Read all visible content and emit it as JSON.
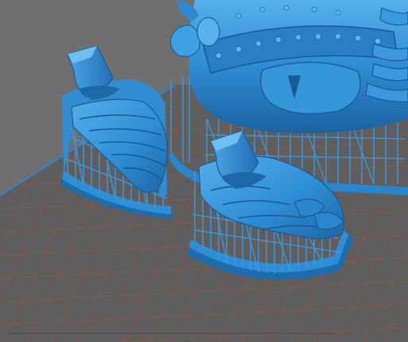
{
  "viewport": {
    "background_color": "#6f6f6f",
    "build_plate": {
      "fill": "#5d5d5d",
      "grid_color": "#a0533c",
      "border_color": "#3d7fc2"
    },
    "model_color": "#2f8fd6",
    "model_shadow_color": "#1c5f98",
    "model_highlight_color": "#63b8ee",
    "support_color": "#3a97db"
  },
  "objects": [
    {
      "name": "left-foot",
      "kind": "model-part",
      "has_supports": true
    },
    {
      "name": "right-foot",
      "kind": "model-part",
      "has_supports": true
    },
    {
      "name": "body",
      "kind": "model-part",
      "has_supports": true
    }
  ]
}
